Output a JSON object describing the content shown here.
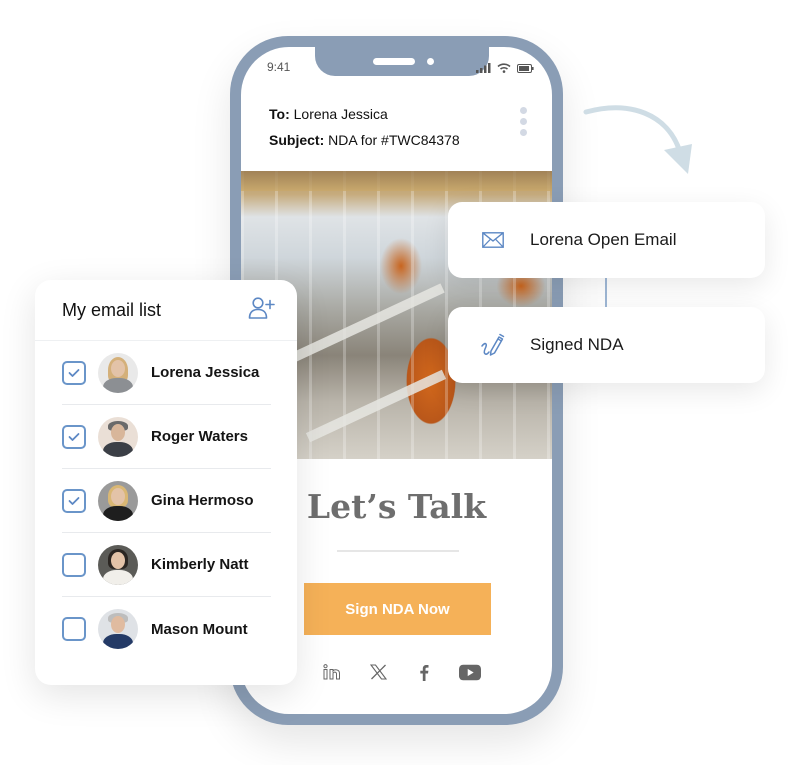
{
  "phone": {
    "status_time": "9:41",
    "email": {
      "to_label": "To:",
      "to_value": "Lorena Jessica",
      "subject_label": "Subject:",
      "subject_value": "NDA for #TWC84378"
    },
    "headline": "Let’s Talk",
    "cta_label": "Sign NDA Now",
    "socials": [
      "linkedin-icon",
      "x-icon",
      "facebook-icon",
      "youtube-icon"
    ]
  },
  "notifications": [
    {
      "icon": "envelope-icon",
      "label": "Lorena Open Email"
    },
    {
      "icon": "signature-pen-icon",
      "label": "Signed NDA"
    }
  ],
  "email_list": {
    "title": "My email list",
    "add_icon": "add-user-icon",
    "contacts": [
      {
        "name": "Lorena Jessica",
        "checked": true
      },
      {
        "name": "Roger Waters",
        "checked": true
      },
      {
        "name": "Gina Hermoso",
        "checked": true
      },
      {
        "name": "Kimberly Natt",
        "checked": false
      },
      {
        "name": "Mason Mount",
        "checked": false
      }
    ]
  },
  "colors": {
    "phone_frame": "#8a9db5",
    "accent_blue": "#6a95c9",
    "cta": "#f5b158",
    "arrow": "#cfdde5"
  }
}
